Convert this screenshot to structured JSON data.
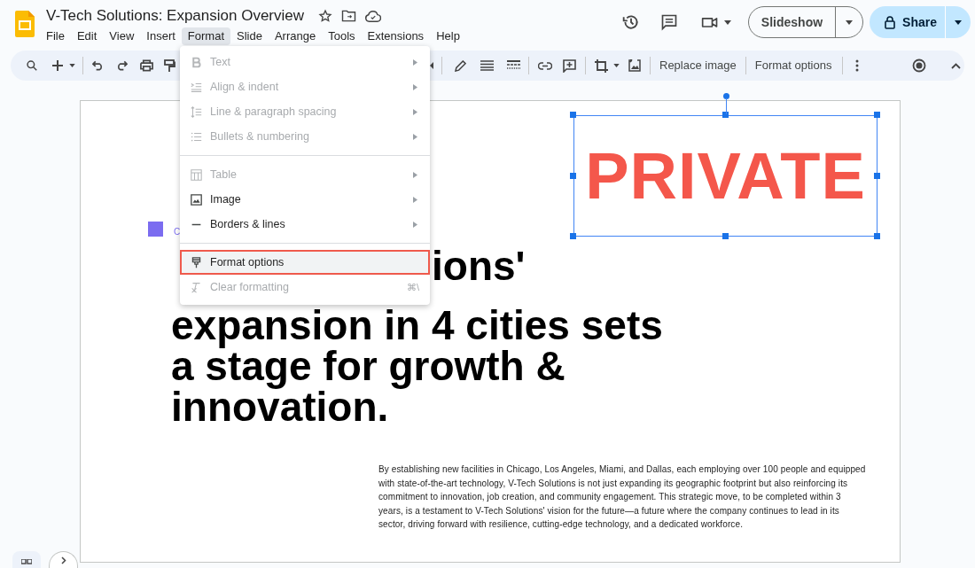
{
  "document": {
    "title": "V-Tech Solutions: Expansion Overview"
  },
  "menu_bar": [
    {
      "label": "File",
      "selected": false
    },
    {
      "label": "Edit",
      "selected": false
    },
    {
      "label": "View",
      "selected": false
    },
    {
      "label": "Insert",
      "selected": false
    },
    {
      "label": "Format",
      "selected": true
    },
    {
      "label": "Slide",
      "selected": false
    },
    {
      "label": "Arrange",
      "selected": false
    },
    {
      "label": "Tools",
      "selected": false
    },
    {
      "label": "Extensions",
      "selected": false
    },
    {
      "label": "Help",
      "selected": false
    }
  ],
  "header_buttons": {
    "slideshow": "Slideshow",
    "share": "Share"
  },
  "toolbar": {
    "text_buttons": [
      "Replace image",
      "Format options"
    ]
  },
  "format_menu": {
    "sections": [
      [
        {
          "label": "Text",
          "disabled": true,
          "submenu": true,
          "highlighted": false
        },
        {
          "label": "Align & indent",
          "disabled": true,
          "submenu": true,
          "highlighted": false
        },
        {
          "label": "Line & paragraph spacing",
          "disabled": true,
          "submenu": true,
          "highlighted": false
        },
        {
          "label": "Bullets & numbering",
          "disabled": true,
          "submenu": true,
          "highlighted": false
        }
      ],
      [
        {
          "label": "Table",
          "disabled": true,
          "submenu": true,
          "highlighted": false
        },
        {
          "label": "Image",
          "disabled": false,
          "submenu": true,
          "highlighted": false
        },
        {
          "label": "Borders & lines",
          "disabled": false,
          "submenu": true,
          "highlighted": false
        }
      ],
      [
        {
          "label": "Format options",
          "disabled": false,
          "submenu": false,
          "highlighted": true
        },
        {
          "label": "Clear formatting",
          "disabled": true,
          "submenu": false,
          "highlighted": false,
          "shortcut": "⌘\\"
        }
      ]
    ]
  },
  "slide": {
    "tag": {
      "text": "C",
      "color": "#7b6cf0"
    },
    "heading_first_line": "ions'",
    "heading_lines": [
      "expansion in 4 cities sets",
      "a stage for growth &",
      "innovation."
    ],
    "stamp": {
      "text": "PRIVATE",
      "selected": true
    },
    "body": "By establishing new facilities in Chicago, Los Angeles, Miami, and Dallas, each employing over 100 people and equipped with state-of-the-art technology, V-Tech Solutions is not just expanding its geographic footprint but also reinforcing its commitment to innovation, job creation, and community engagement. This strategic move, to be completed within 3 years, is a testament to V-Tech Solutions' vision for the future—a future where the company continues to lead in its sector, driving forward with resilience, cutting-edge technology, and a dedicated workforce."
  }
}
